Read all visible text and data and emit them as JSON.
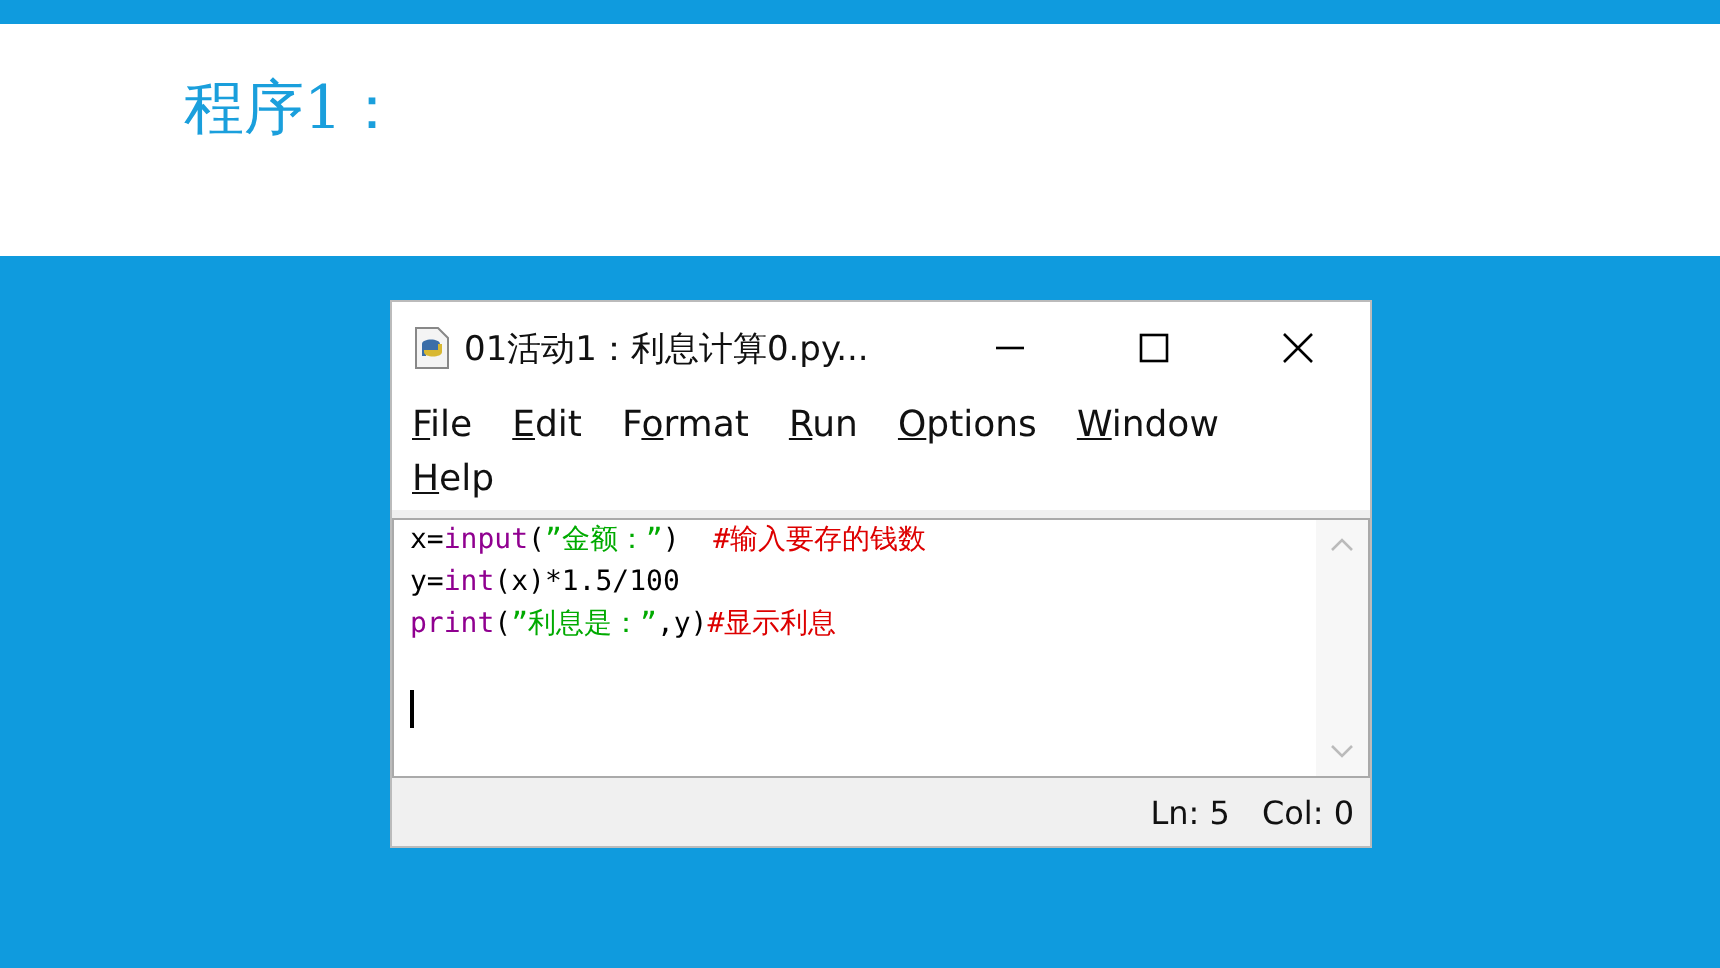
{
  "heading": "程序1：",
  "window": {
    "title": "01活动1：利息计算0.py..."
  },
  "menu": [
    {
      "key": "F",
      "after": "ile"
    },
    {
      "key": "E",
      "after": "dit"
    },
    {
      "before": "F",
      "key": "o",
      "after": "rmat"
    },
    {
      "key": "R",
      "after": "un"
    },
    {
      "key": "O",
      "after": "ptions"
    },
    {
      "key": "W",
      "after": "indow"
    },
    {
      "key": "H",
      "after": "elp"
    }
  ],
  "code_lines": [
    {
      "cursor": false,
      "tokens": [
        {
          "kind": "plain",
          "text": "x="
        },
        {
          "kind": "builtin",
          "text": "input"
        },
        {
          "kind": "plain",
          "text": "("
        },
        {
          "kind": "string",
          "text": "”金额：”"
        },
        {
          "kind": "plain",
          "text": ")  "
        },
        {
          "kind": "comment",
          "text": "#输入要存的钱数"
        }
      ]
    },
    {
      "cursor": false,
      "tokens": [
        {
          "kind": "plain",
          "text": "y="
        },
        {
          "kind": "builtin",
          "text": "int"
        },
        {
          "kind": "plain",
          "text": "(x)*1.5/100"
        }
      ]
    },
    {
      "cursor": false,
      "tokens": [
        {
          "kind": "builtin",
          "text": "print"
        },
        {
          "kind": "plain",
          "text": "("
        },
        {
          "kind": "string",
          "text": "”利息是：”"
        },
        {
          "kind": "plain",
          "text": ",y)"
        },
        {
          "kind": "comment",
          "text": "#显示利息"
        }
      ]
    },
    {
      "cursor": false
    },
    {
      "cursor": true
    }
  ],
  "status_bar": {
    "line": "Ln: 5",
    "column": "Col: 0"
  }
}
